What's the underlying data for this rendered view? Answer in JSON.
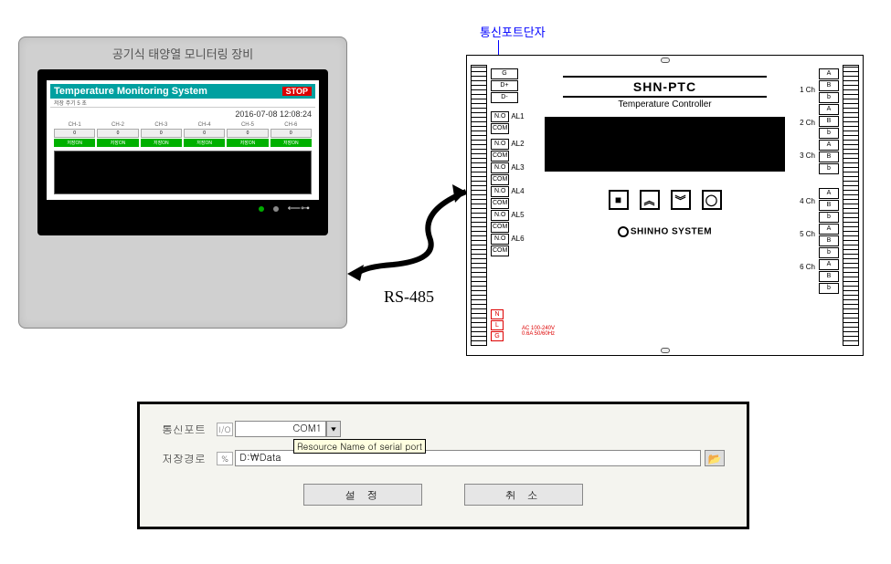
{
  "monitor": {
    "device_label": "공기식 태양열 모니터링 장비",
    "screen_title": "Temperature Monitoring System",
    "stop_label": "STOP",
    "datetime": "2016-07-08 12:08:24",
    "sub_label": "저장 주기 5 초",
    "channels": [
      {
        "label": "CH-1",
        "value": "0",
        "status": "저장ON"
      },
      {
        "label": "CH-2",
        "value": "0",
        "status": "저장ON"
      },
      {
        "label": "CH-3",
        "value": "0",
        "status": "저장ON"
      },
      {
        "label": "CH-4",
        "value": "0",
        "status": "저장ON"
      },
      {
        "label": "CH-5",
        "value": "0",
        "status": "저장ON"
      },
      {
        "label": "CH-6",
        "value": "0",
        "status": "저장ON"
      }
    ],
    "usb_glyph": "⟵⊶"
  },
  "link_label": "RS-485",
  "callout": "통신포트단자",
  "controller": {
    "model": "SHN-PTC",
    "subtitle": "Temperature Controller",
    "brand": "SHINHO SYSTEM",
    "comm_pins": [
      "G",
      "D+",
      "D-"
    ],
    "alarm_pin_pair": [
      "N.O",
      "COM"
    ],
    "alarms": [
      "AL1",
      "AL2",
      "AL3",
      "AL4",
      "AL5",
      "AL6"
    ],
    "power_pins": [
      "N",
      "L",
      "G"
    ],
    "power_spec": "AC 100-240V\n0.6A 50/60Hz",
    "ch_labels": [
      "1 Ch",
      "2 Ch",
      "3 Ch",
      "4 Ch",
      "5 Ch",
      "6 Ch"
    ],
    "ch_pins": [
      "A",
      "B",
      "b"
    ],
    "buttons": {
      "stop": "■",
      "up": "︽",
      "down": "︾",
      "cycle": "◯"
    }
  },
  "settings": {
    "port_label": "통신포트",
    "path_label": "저장경로",
    "port_value": "COM1",
    "io_glyph": "I/O",
    "tooltip": "Resource Name of serial port",
    "path_prefix": "%",
    "path_value": "D:\\Data",
    "browse_glyph": "📂",
    "ok_label": "설 정",
    "cancel_label": "취 소"
  }
}
